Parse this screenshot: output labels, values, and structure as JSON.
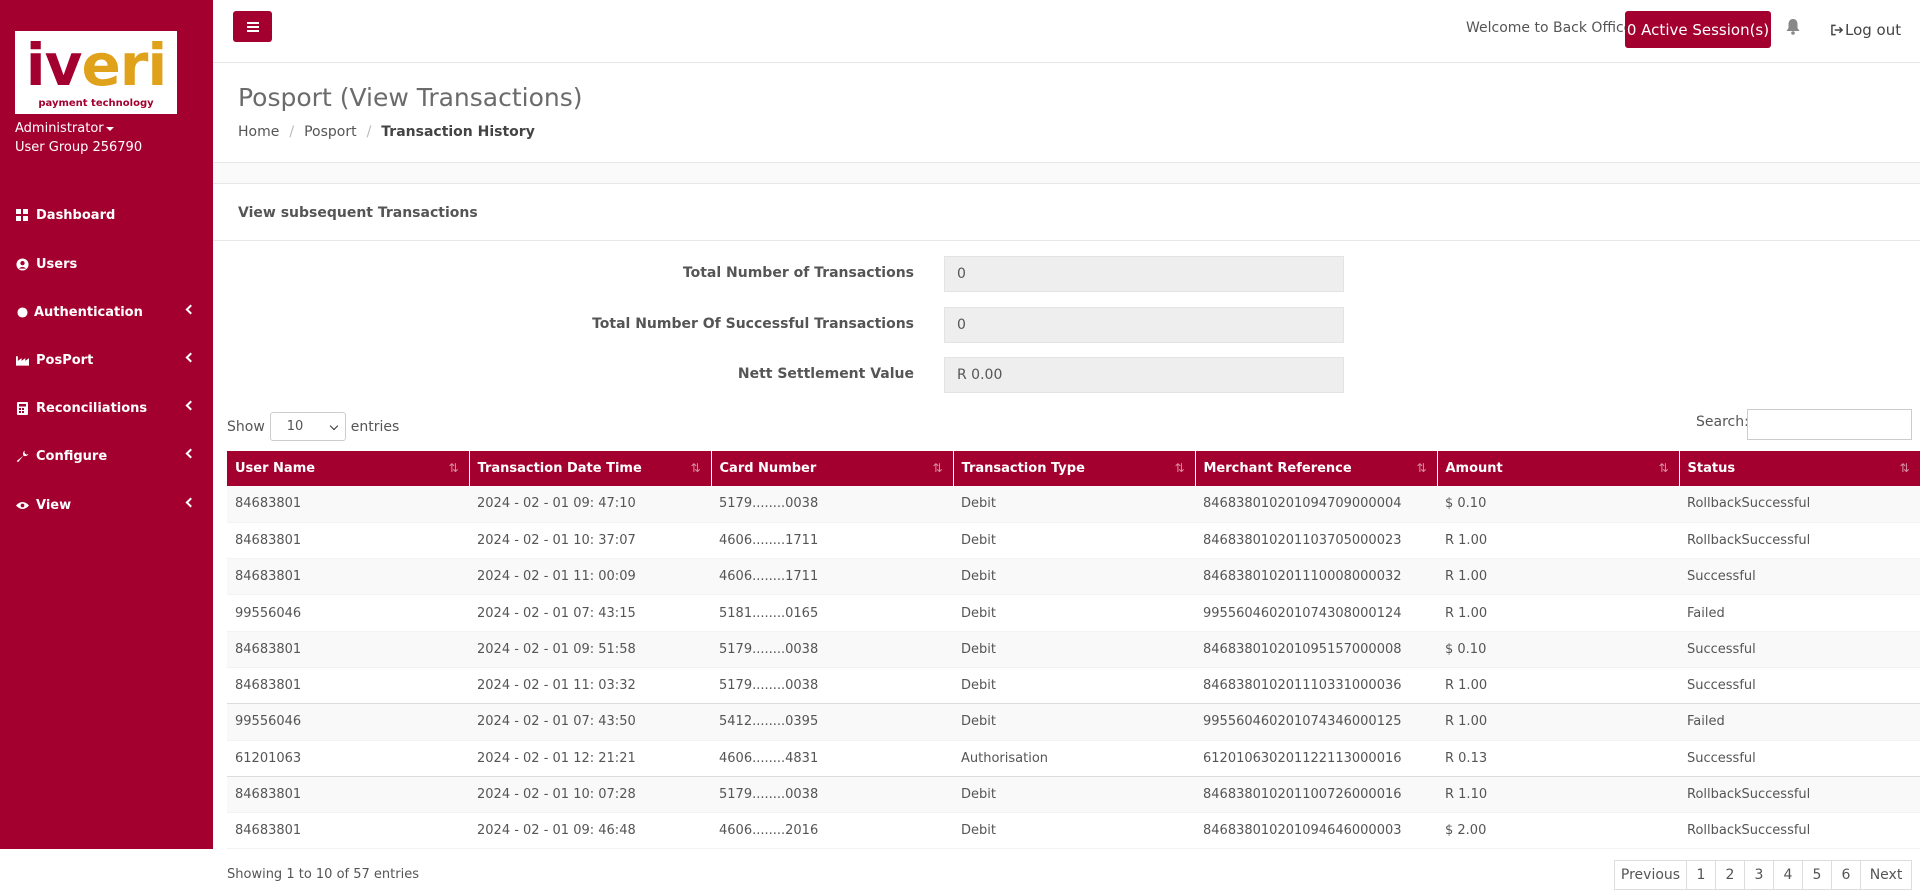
{
  "sidebar": {
    "logo": {
      "word_i": "i",
      "word_v": "v",
      "word_eri": "eri",
      "tagline": "payment technology"
    },
    "user_role": "Administrator",
    "user_group": "User Group 256790",
    "items": [
      {
        "label": "Dashboard",
        "icon": "grid-icon",
        "has_submenu": false
      },
      {
        "label": "Users",
        "icon": "user-circle-icon",
        "has_submenu": false
      },
      {
        "label": "Authentication",
        "icon": "dot-icon",
        "has_submenu": true
      },
      {
        "label": "PosPort",
        "icon": "factory-icon",
        "has_submenu": true
      },
      {
        "label": "Reconciliations",
        "icon": "calculator-icon",
        "has_submenu": true
      },
      {
        "label": "Configure",
        "icon": "wrench-icon",
        "has_submenu": true
      },
      {
        "label": "View",
        "icon": "eye-icon",
        "has_submenu": true
      }
    ]
  },
  "topbar": {
    "welcome": "Welcome to Back Office",
    "sessions_button": "0 Active Session(s)",
    "logout": "Log out"
  },
  "page": {
    "title": "Posport (View Transactions)",
    "breadcrumb": [
      "Home",
      "Posport",
      "Transaction History"
    ]
  },
  "panel": {
    "title": "View subsequent Transactions",
    "fields": [
      {
        "label": "Total Number of Transactions",
        "value": "0"
      },
      {
        "label": "Total Number Of Successful Transactions",
        "value": "0"
      },
      {
        "label": "Nett Settlement Value",
        "value": "R 0.00"
      }
    ]
  },
  "table_controls": {
    "show_label": "Show",
    "entries_value": "10",
    "entries_label": "entries",
    "search_label": "Search:"
  },
  "table": {
    "columns": [
      "User Name",
      "Transaction Date Time",
      "Card Number",
      "Transaction Type",
      "Merchant Reference",
      "Amount",
      "Status"
    ],
    "rows": [
      [
        "84683801",
        "2024 - 02 - 01 09: 47:10",
        "5179........0038",
        "Debit",
        "846838010201094709000004",
        "$ 0.10",
        "RollbackSuccessful"
      ],
      [
        "84683801",
        "2024 - 02 - 01 10: 37:07",
        "4606........1711",
        "Debit",
        "846838010201103705000023",
        "R 1.00",
        "RollbackSuccessful"
      ],
      [
        "84683801",
        "2024 - 02 - 01 11: 00:09",
        "4606........1711",
        "Debit",
        "846838010201110008000032",
        "R 1.00",
        "Successful"
      ],
      [
        "99556046",
        "2024 - 02 - 01 07: 43:15",
        "5181........0165",
        "Debit",
        "995560460201074308000124",
        "R 1.00",
        "Failed"
      ],
      [
        "84683801",
        "2024 - 02 - 01 09: 51:58",
        "5179........0038",
        "Debit",
        "846838010201095157000008",
        "$ 0.10",
        "Successful"
      ],
      [
        "84683801",
        "2024 - 02 - 01 11: 03:32",
        "5179........0038",
        "Debit",
        "846838010201110331000036",
        "R 1.00",
        "Successful"
      ],
      [
        "99556046",
        "2024 - 02 - 01 07: 43:50",
        "5412........0395",
        "Debit",
        "995560460201074346000125",
        "R 1.00",
        "Failed"
      ],
      [
        "61201063",
        "2024 - 02 - 01 12: 21:21",
        "4606........4831",
        "Authorisation",
        "612010630201122113000016",
        "R 0.13",
        "Successful"
      ],
      [
        "84683801",
        "2024 - 02 - 01 10: 07:28",
        "5179........0038",
        "Debit",
        "846838010201100726000016",
        "R 1.10",
        "RollbackSuccessful"
      ],
      [
        "84683801",
        "2024 - 02 - 01 09: 46:48",
        "4606........2016",
        "Debit",
        "846838010201094646000003",
        "$ 2.00",
        "RollbackSuccessful"
      ]
    ]
  },
  "footer": {
    "info": "Showing 1 to 10 of 57 entries",
    "pagination": {
      "previous": "Previous",
      "pages": [
        "1",
        "2",
        "3",
        "4",
        "5",
        "6"
      ],
      "next": "Next"
    }
  },
  "colors": {
    "brand": "#a3002f",
    "logo_accent": "#e0a11b"
  }
}
